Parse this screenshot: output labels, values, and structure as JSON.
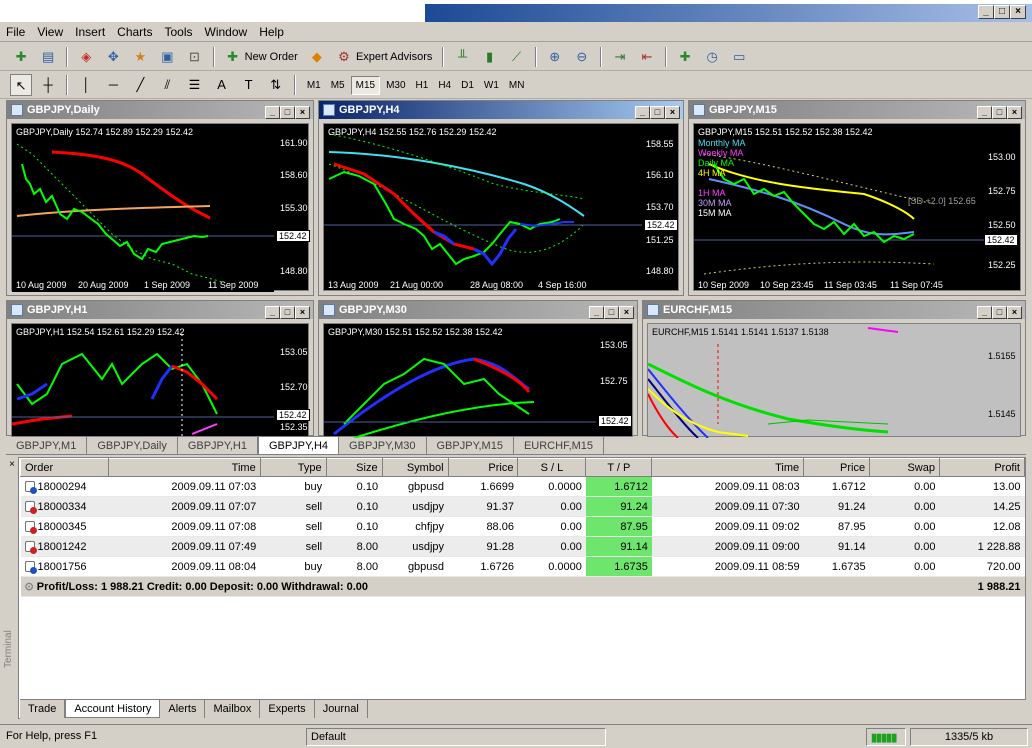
{
  "menu": [
    "File",
    "View",
    "Insert",
    "Charts",
    "Tools",
    "Window",
    "Help"
  ],
  "toolbar": {
    "new_order": "New Order",
    "expert_advisors": "Expert Advisors"
  },
  "timeframes": [
    "M1",
    "M5",
    "M15",
    "M30",
    "H1",
    "H4",
    "D1",
    "W1",
    "MN"
  ],
  "active_timeframe": "M15",
  "mdi_controls": [
    "_",
    "□",
    "×"
  ],
  "charts": [
    {
      "title": "GBPJPY,Daily",
      "info": "GBPJPY,Daily  152.74 152.89 152.29 152.42",
      "prices": [
        "161.90",
        "158.60",
        "155.30",
        "152.42",
        "148.80"
      ],
      "dates": [
        "10 Aug 2009",
        "20 Aug 2009",
        "1 Sep 2009",
        "11 Sep 2009"
      ]
    },
    {
      "title": "GBPJPY,H4",
      "info": "GBPJPY,H4  152.55 152.76 152.29 152.42",
      "prices": [
        "158.55",
        "156.10",
        "153.70",
        "152.42",
        "151.25",
        "148.80"
      ],
      "dates": [
        "13 Aug 2009",
        "21 Aug 00:00",
        "28 Aug 08:00",
        "4 Sep 16:00"
      ]
    },
    {
      "title": "GBPJPY,M15",
      "info": "GBPJPY,M15  152.51 152.52 152.38 152.42",
      "prices": [
        "153.00",
        "152.75",
        "152.50",
        "152.42",
        "152.25"
      ],
      "dates": [
        "10 Sep 2009",
        "10 Sep 23:45",
        "11 Sep 03:45",
        "11 Sep 07:45"
      ],
      "legend": [
        "Monthly MA",
        "Weekly MA",
        "Daily MA",
        "4H MA",
        "1H MA",
        "30M MA",
        "15M MA"
      ],
      "sd": "[SD +2.0] 152.65"
    },
    {
      "title": "GBPJPY,H1",
      "info": "GBPJPY,H1  152.54 152.61 152.29 152.42",
      "prices": [
        "153.05",
        "152.70",
        "152.42",
        "152.35"
      ]
    },
    {
      "title": "GBPJPY,M30",
      "info": "GBPJPY,M30  152.51 152.52 152.38 152.42",
      "prices": [
        "153.05",
        "152.75",
        "152.42"
      ]
    },
    {
      "title": "EURCHF,M15",
      "info": "EURCHF,M15  1.5141 1.5141 1.5137 1.5138",
      "prices": [
        "1.5155",
        "1.5145"
      ]
    }
  ],
  "doc_tabs": [
    "GBPJPY,M1",
    "GBPJPY,Daily",
    "GBPJPY,H1",
    "GBPJPY,H4",
    "GBPJPY,M30",
    "GBPJPY,M15",
    "EURCHF,M15"
  ],
  "active_doc_tab": "GBPJPY,H4",
  "table": {
    "headers": [
      "Order",
      "Time",
      "Type",
      "Size",
      "Symbol",
      "Price",
      "S / L",
      "T / P",
      "Time",
      "Price",
      "Swap",
      "Profit"
    ],
    "rows": [
      {
        "icon": "buy",
        "cells": [
          "18000294",
          "2009.09.11 07:03",
          "buy",
          "0.10",
          "gbpusd",
          "1.6699",
          "0.0000",
          "1.6712",
          "2009.09.11 08:03",
          "1.6712",
          "0.00",
          "13.00"
        ]
      },
      {
        "icon": "sell",
        "cells": [
          "18000334",
          "2009.09.11 07:07",
          "sell",
          "0.10",
          "usdjpy",
          "91.37",
          "0.00",
          "91.24",
          "2009.09.11 07:30",
          "91.24",
          "0.00",
          "14.25"
        ]
      },
      {
        "icon": "sell",
        "cells": [
          "18000345",
          "2009.09.11 07:08",
          "sell",
          "0.10",
          "chfjpy",
          "88.06",
          "0.00",
          "87.95",
          "2009.09.11 09:02",
          "87.95",
          "0.00",
          "12.08"
        ]
      },
      {
        "icon": "sell",
        "cells": [
          "18001242",
          "2009.09.11 07:49",
          "sell",
          "8.00",
          "usdjpy",
          "91.28",
          "0.00",
          "91.14",
          "2009.09.11 09:00",
          "91.14",
          "0.00",
          "1 228.88"
        ]
      },
      {
        "icon": "buy",
        "cells": [
          "18001756",
          "2009.09.11 08:04",
          "buy",
          "8.00",
          "gbpusd",
          "1.6726",
          "0.0000",
          "1.6735",
          "2009.09.11 08:59",
          "1.6735",
          "0.00",
          "720.00"
        ]
      }
    ],
    "summary": "Profit/Loss: 1 988.21  Credit: 0.00  Deposit: 0.00  Withdrawal: 0.00",
    "summary_total": "1 988.21"
  },
  "terminal_label": "Terminal",
  "term_tabs": [
    "Trade",
    "Account History",
    "Alerts",
    "Mailbox",
    "Experts",
    "Journal"
  ],
  "active_term_tab": "Account History",
  "status": {
    "help": "For Help, press F1",
    "profile": "Default",
    "traffic": "1335/5 kb"
  },
  "colors": {
    "tp_highlight": "#6ee66e",
    "buy_icon": "#2050c0",
    "sell_icon": "#d02020"
  }
}
